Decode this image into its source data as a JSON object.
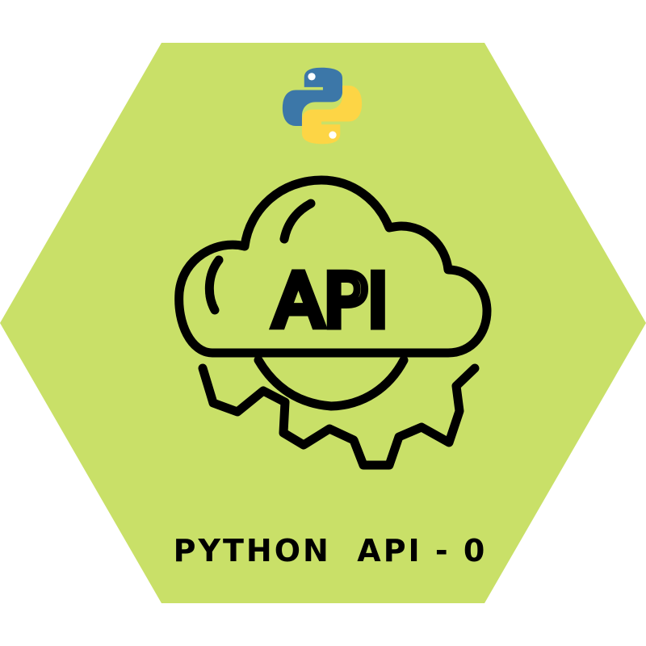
{
  "badge": {
    "title": "PYTHON  API - 0",
    "icon_text": "API",
    "logo": "python-logo",
    "icon": "cloud-gear-api-icon"
  },
  "colors": {
    "hexagon": "#c9e068",
    "ink": "#000000",
    "python_blue": "#3c77a8",
    "python_yellow": "#fdd545",
    "background": "#ffffff"
  }
}
